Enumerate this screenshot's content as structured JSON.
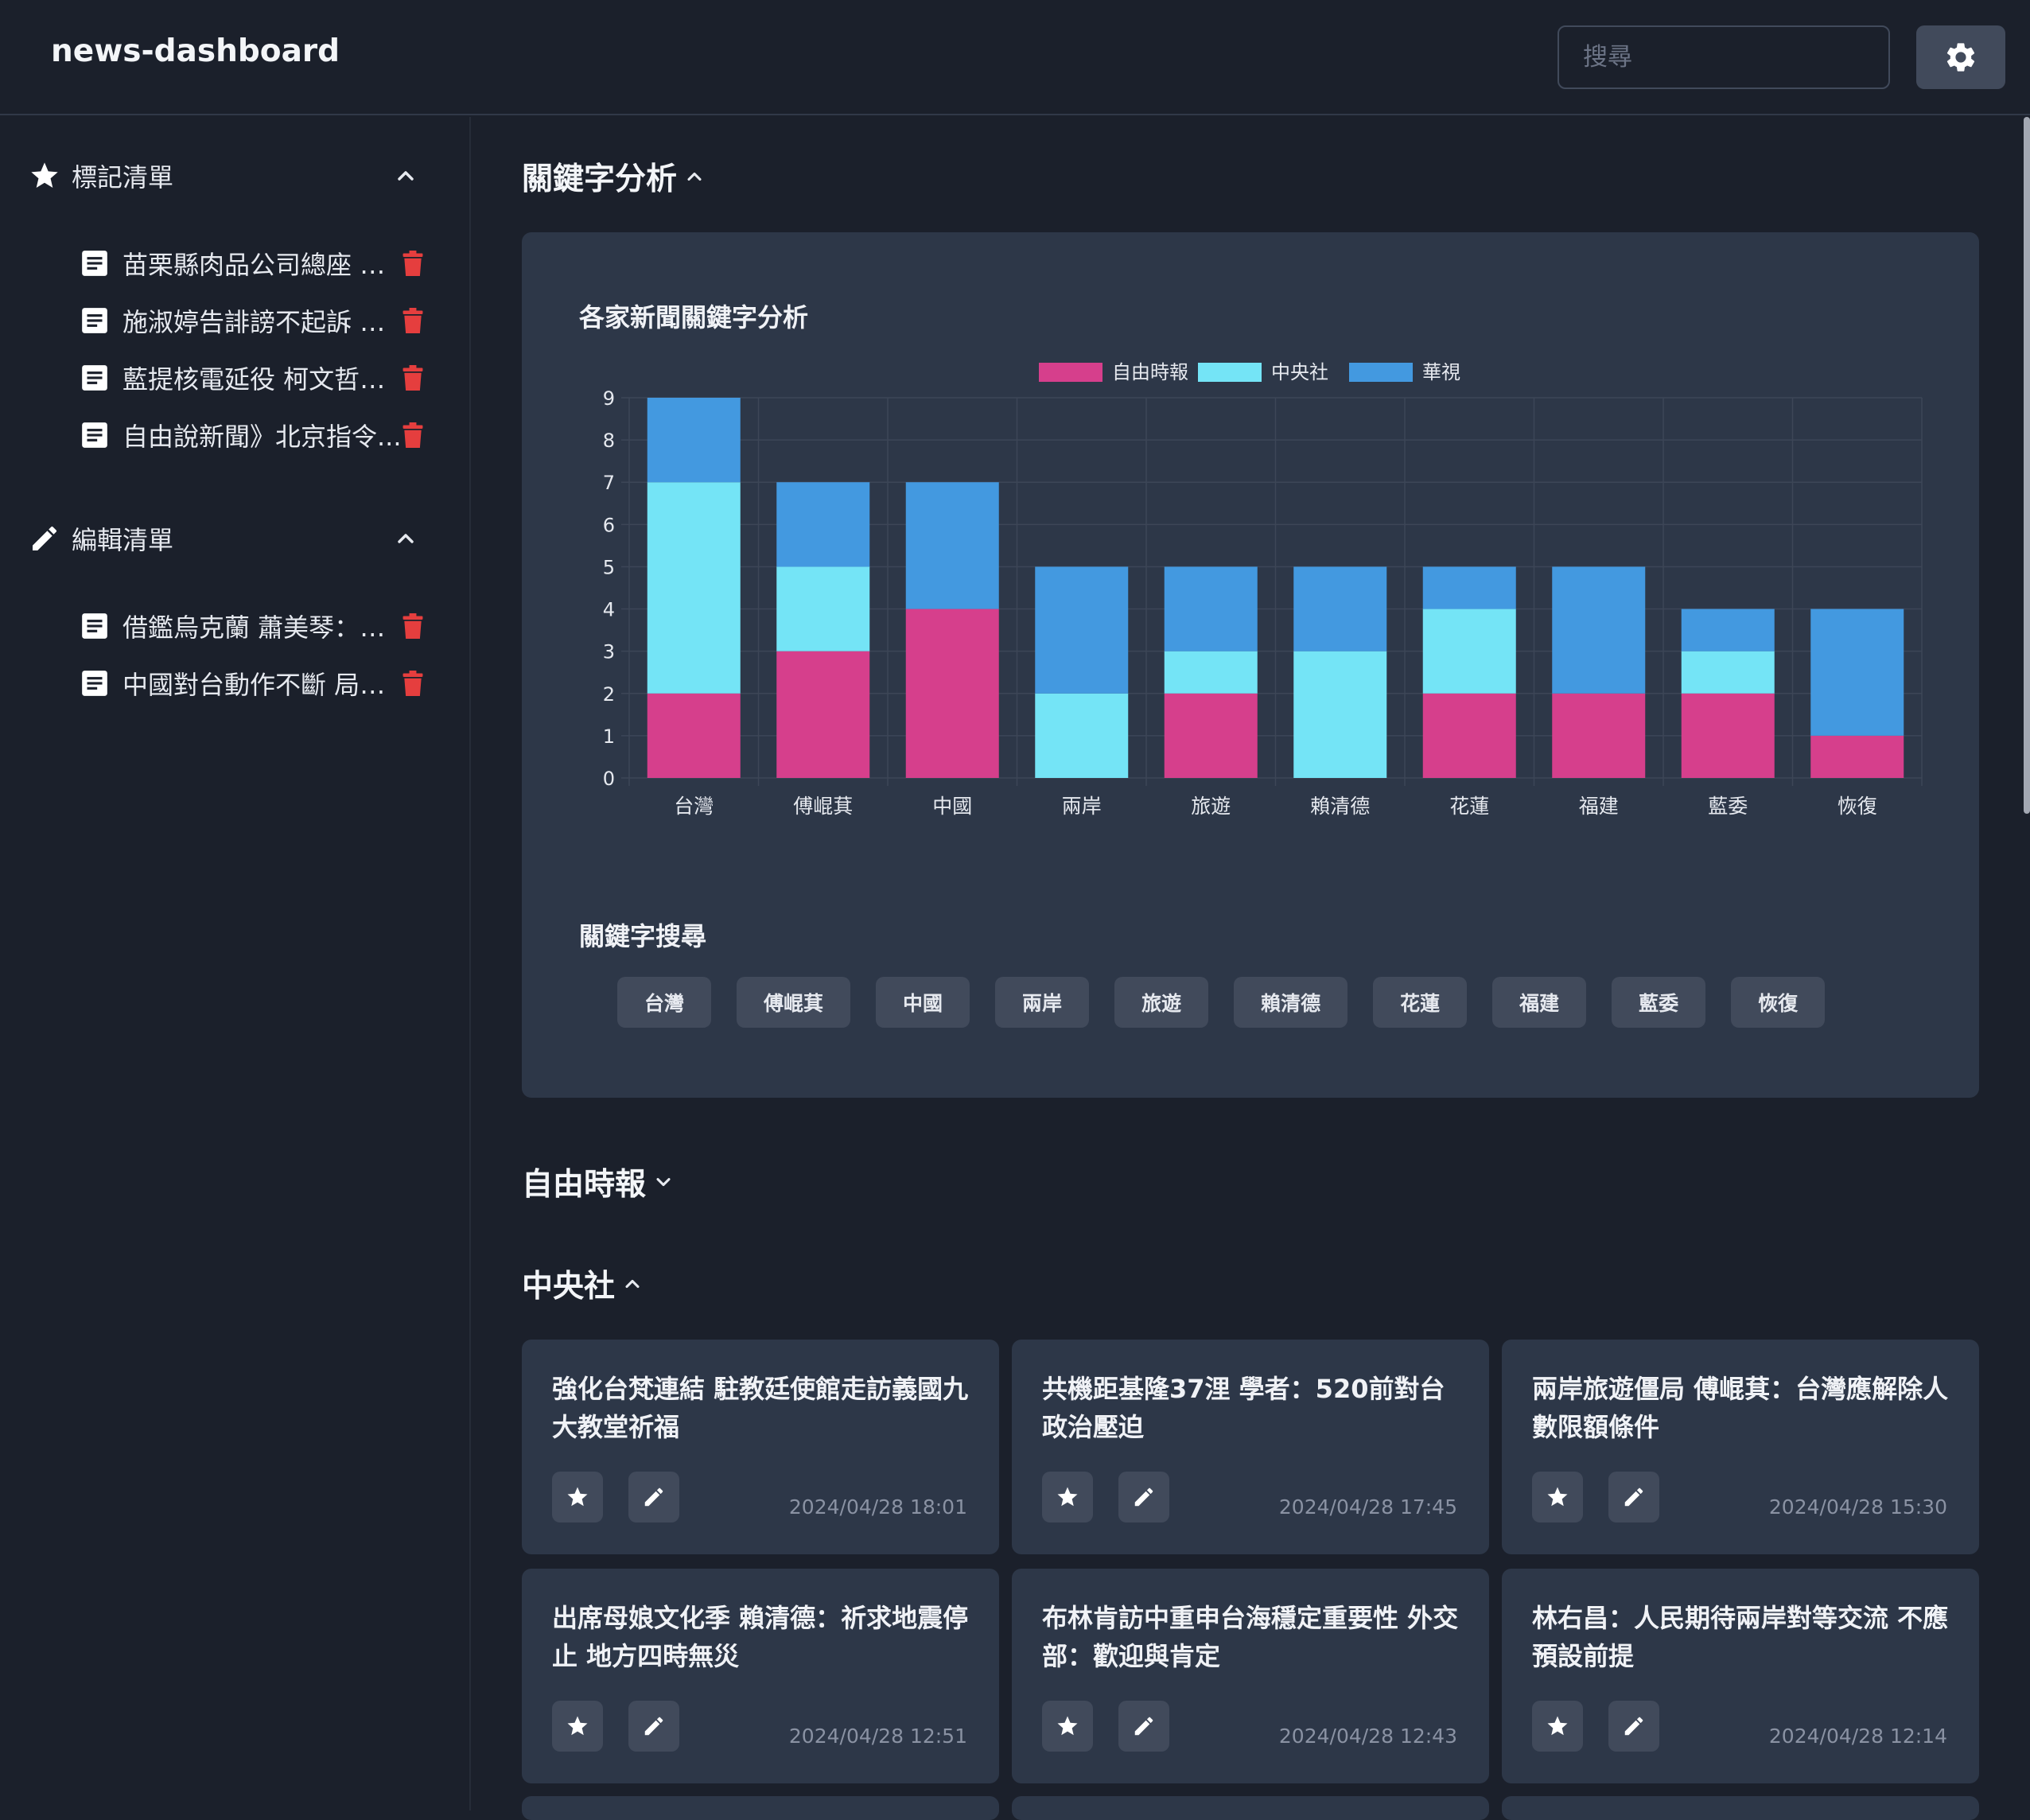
{
  "app": {
    "title": "news-dashboard"
  },
  "search": {
    "placeholder": "搜尋"
  },
  "sidebar": {
    "bookmarks": {
      "title": "標記清單",
      "items": [
        "苗栗縣肉品公司總座 鍾...",
        "施淑婷告誹謗不起訴 林...",
        "藍提核電延役 柯文哲籲...",
        "自由說新聞》北京指令..."
      ]
    },
    "edits": {
      "title": "編輯清單",
      "items": [
        "借鑑烏克蘭 蕭美琴：台...",
        "中國對台動作不斷 局部..."
      ]
    }
  },
  "keyword_section": {
    "title": "關鍵字分析",
    "search_title": "關鍵字搜尋"
  },
  "chart_data": {
    "type": "bar",
    "stacked": true,
    "title": "各家新聞關鍵字分析",
    "categories": [
      "台灣",
      "傅崐萁",
      "中國",
      "兩岸",
      "旅遊",
      "賴清德",
      "花蓮",
      "福建",
      "藍委",
      "恢復"
    ],
    "series": [
      {
        "name": "自由時報",
        "color": "#d63f8c",
        "values": [
          2,
          3,
          4,
          0,
          2,
          0,
          2,
          2,
          2,
          1
        ]
      },
      {
        "name": "中央社",
        "color": "#74e4f6",
        "values": [
          5,
          2,
          0,
          2,
          1,
          3,
          2,
          0,
          1,
          0
        ]
      },
      {
        "name": "華視",
        "color": "#4399e0",
        "values": [
          2,
          2,
          3,
          3,
          2,
          2,
          1,
          3,
          1,
          3
        ]
      }
    ],
    "ylim": [
      0,
      9
    ],
    "yticks": [
      "0",
      "1",
      "2",
      "3",
      "4",
      "5",
      "6",
      "7",
      "8",
      "9"
    ],
    "legend": "top-center",
    "grid": true
  },
  "keyword_chips": [
    "台灣",
    "傅崐萁",
    "中國",
    "兩岸",
    "旅遊",
    "賴清德",
    "花蓮",
    "福建",
    "藍委",
    "恢復"
  ],
  "sources": [
    {
      "title": "自由時報",
      "expanded": false
    },
    {
      "title": "中央社",
      "expanded": true
    }
  ],
  "cards": [
    {
      "title": "強化台梵連結 駐教廷使館走訪義國九大教堂祈福",
      "date": "2024/04/28 18:01"
    },
    {
      "title": "共機距基隆37浬 學者：520前對台政治壓迫",
      "date": "2024/04/28 17:45"
    },
    {
      "title": "兩岸旅遊僵局 傅崐萁：台灣應解除人數限額條件",
      "date": "2024/04/28 15:30"
    },
    {
      "title": "出席母娘文化季 賴清德：祈求地震停止 地方四時無災",
      "date": "2024/04/28 12:51"
    },
    {
      "title": "布林肯訪中重申台海穩定重要性 外交部：歡迎與肯定",
      "date": "2024/04/28 12:43"
    },
    {
      "title": "林右昌：人民期待兩岸對等交流 不應預設前提",
      "date": "2024/04/28 12:14"
    }
  ],
  "icons": {
    "settings": "gear-icon",
    "bookmarks": "star-icon",
    "edits": "pencil-icon",
    "item": "document-icon",
    "delete": "trash-icon"
  },
  "colors": {
    "background": "#1b202b",
    "panel": "#2d3748",
    "button": "#414a5b",
    "delete": "#e53e3e"
  }
}
